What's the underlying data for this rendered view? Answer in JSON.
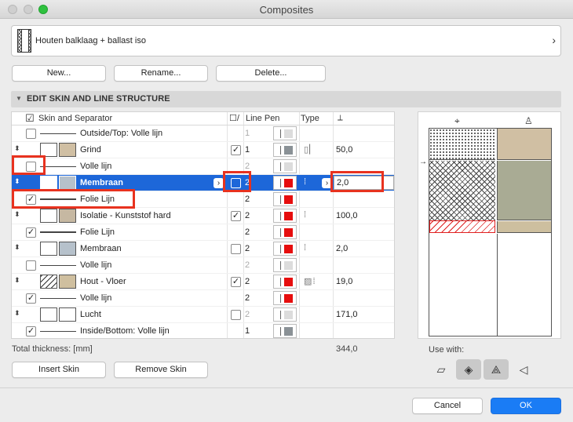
{
  "window": {
    "title": "Composites"
  },
  "selector": {
    "name": "Houten balklaag + ballast iso"
  },
  "buttons": {
    "new": "New...",
    "rename": "Rename...",
    "delete": "Delete...",
    "insert_skin": "Insert Skin",
    "remove_skin": "Remove Skin",
    "cancel": "Cancel",
    "ok": "OK"
  },
  "section": {
    "label": "EDIT SKIN AND LINE STRUCTURE"
  },
  "columns": {
    "skin": "Skin and Separator",
    "check": "☐/",
    "line_pen": "Line Pen",
    "type": "Type"
  },
  "rows": [
    {
      "name": "Outside/Top: Volle lijn",
      "pen": "1"
    },
    {
      "name": "Grind",
      "pen": "1",
      "thickness": "50,0"
    },
    {
      "name": "Volle lijn",
      "pen": "2"
    },
    {
      "name": "Membraan",
      "pen": "2",
      "thickness": "2,0"
    },
    {
      "name": "Folie Lijn",
      "pen": "2"
    },
    {
      "name": "Isolatie - Kunststof hard",
      "pen": "2",
      "thickness": "100,0"
    },
    {
      "name": "Folie Lijn",
      "pen": "2"
    },
    {
      "name": "Membraan",
      "pen": "2",
      "thickness": "2,0"
    },
    {
      "name": "Volle lijn",
      "pen": "2"
    },
    {
      "name": "Hout - Vloer",
      "pen": "2",
      "thickness": "19,0"
    },
    {
      "name": "Volle lijn",
      "pen": "2"
    },
    {
      "name": "Lucht",
      "pen": "2",
      "thickness": "171,0"
    },
    {
      "name": "Inside/Bottom: Volle lijn",
      "pen": "1"
    }
  ],
  "footer": {
    "total_label": "Total thickness: [mm]",
    "total_value": "344,0",
    "use_with": "Use with:"
  },
  "colors": {
    "selection": "#1d67d9",
    "highlight": "#e8321f",
    "grind": "#d0bfa3",
    "membraan": "#b6c1cb",
    "isolatie": "#c6b8a2",
    "hout": "#cfbf9f",
    "pen_red": "#e60d0d",
    "pen_gray": "#8a9196"
  }
}
